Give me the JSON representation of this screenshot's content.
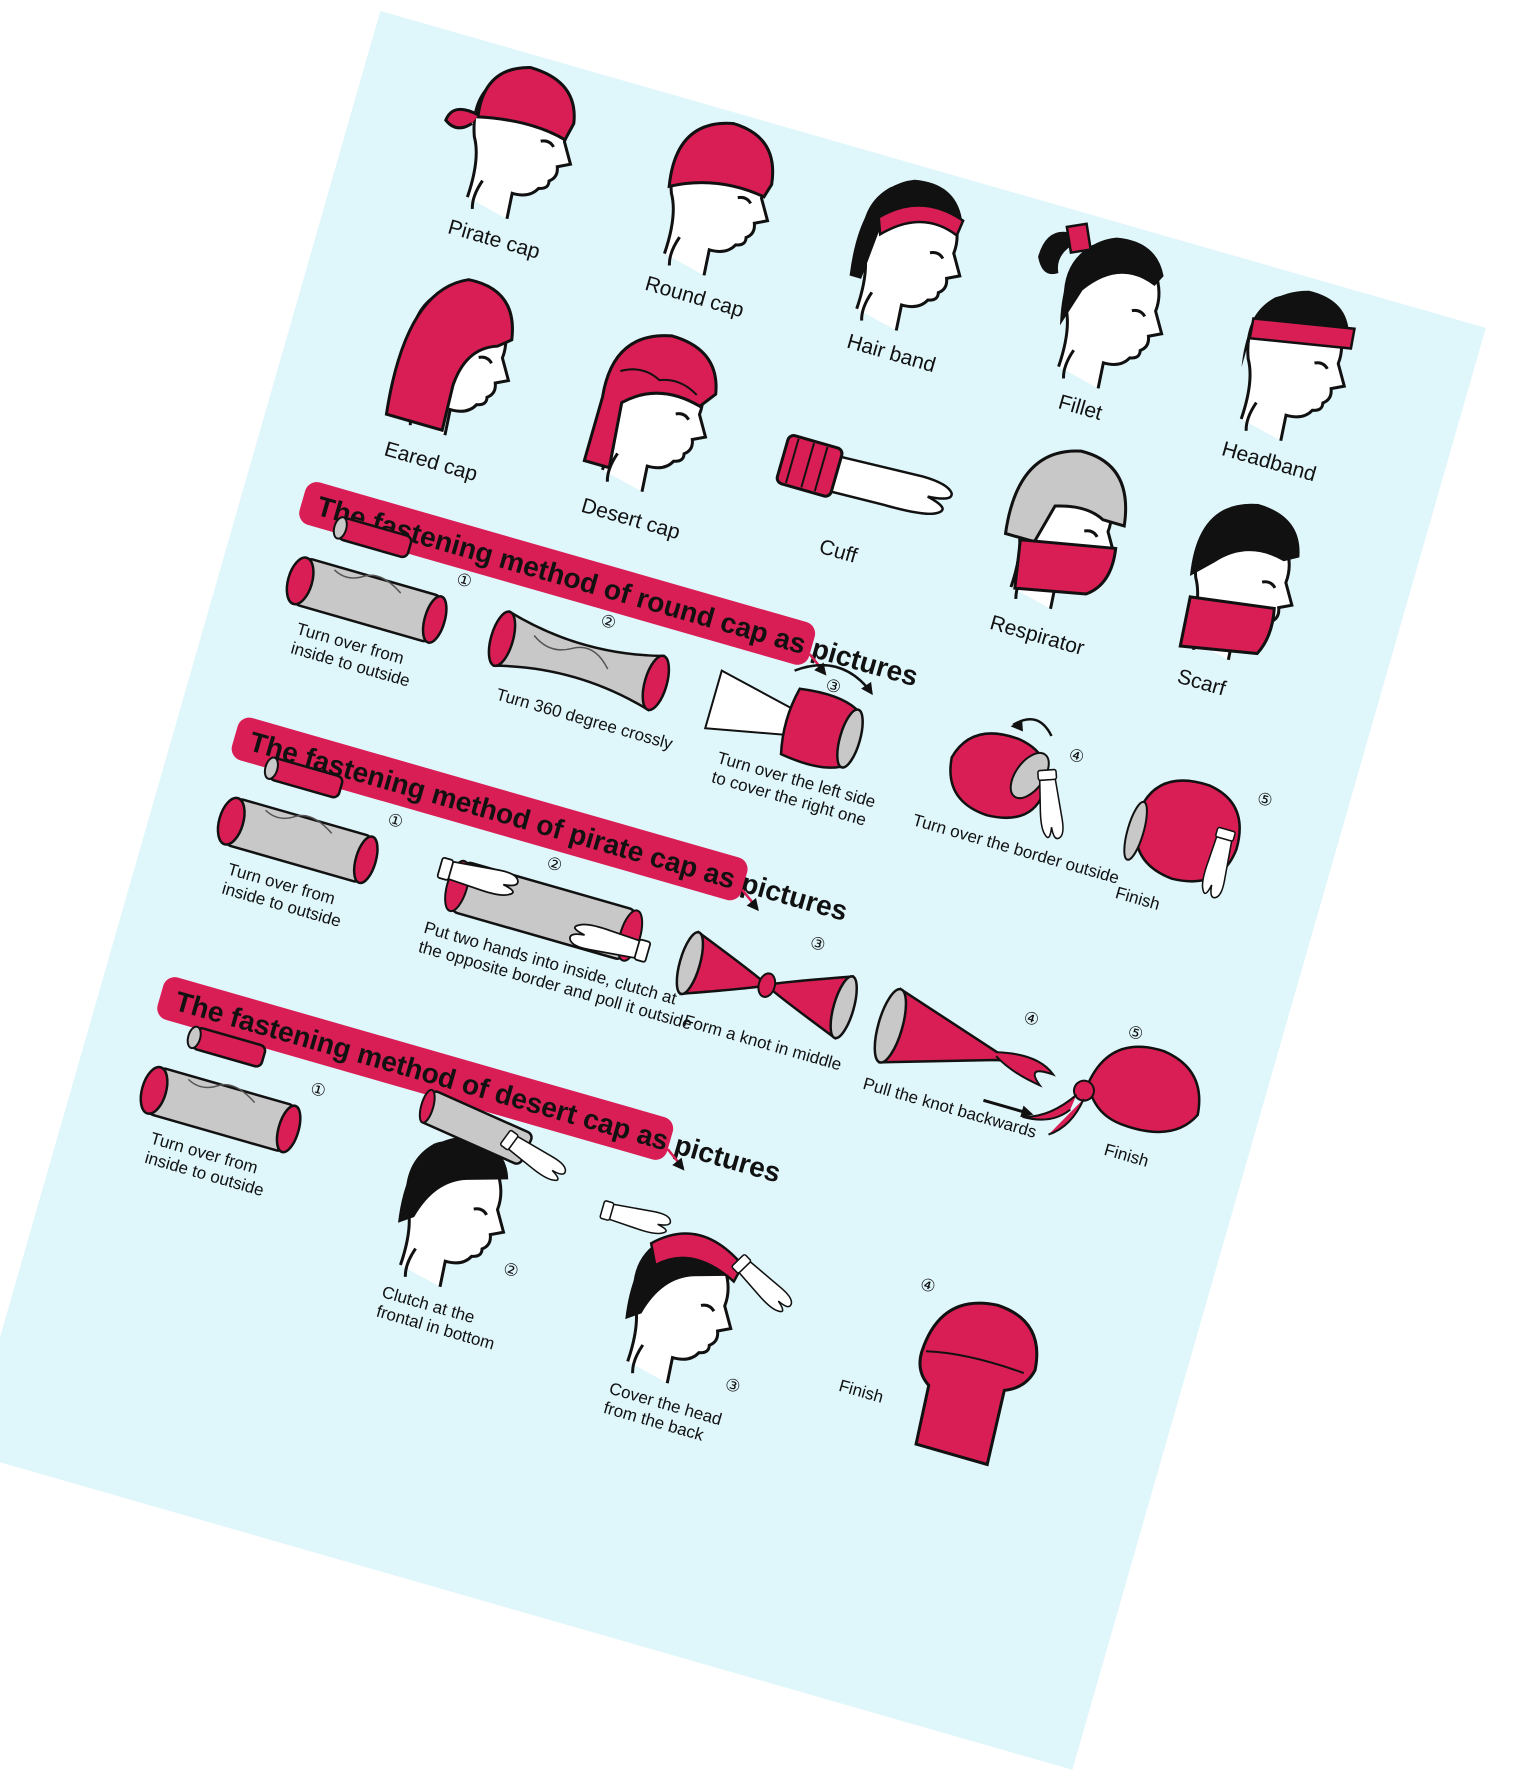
{
  "colors": {
    "accent": "#d81e54",
    "sheet": "#dff6fb",
    "ink": "#111111",
    "grey": "#c8c8c8"
  },
  "styles": [
    {
      "name": "Pirate cap"
    },
    {
      "name": "Round cap"
    },
    {
      "name": "Hair band"
    },
    {
      "name": "Fillet"
    },
    {
      "name": "Headband"
    },
    {
      "name": "Eared cap"
    },
    {
      "name": "Desert cap"
    },
    {
      "name": "Cuff"
    },
    {
      "name": "Respirator"
    },
    {
      "name": "Scarf"
    }
  ],
  "sections": [
    {
      "title": "The fastening method of round cap as pictures",
      "steps": [
        {
          "num": "①",
          "label": [
            "Turn over from",
            "inside to outside"
          ]
        },
        {
          "num": "②",
          "label": [
            "Turn 360 degree crossly"
          ]
        },
        {
          "num": "③",
          "label": [
            "Turn over the left side",
            "to cover the right one"
          ]
        },
        {
          "num": "④",
          "label": [
            "Turn over the border outside"
          ]
        },
        {
          "num": "⑤",
          "label": [
            "Finish"
          ]
        }
      ]
    },
    {
      "title": "The fastening method of pirate cap as pictures",
      "steps": [
        {
          "num": "①",
          "label": [
            "Turn over from",
            "inside to outside"
          ]
        },
        {
          "num": "②",
          "label": [
            "Put two hands into inside, clutch at",
            "the opposite border and poll it outside"
          ]
        },
        {
          "num": "③",
          "label": [
            "Form a knot in middle"
          ]
        },
        {
          "num": "④",
          "label": [
            "Pull the knot backwards"
          ]
        },
        {
          "num": "⑤",
          "label": [
            "Finish"
          ]
        }
      ]
    },
    {
      "title": "The fastening method of desert cap as pictures",
      "steps": [
        {
          "num": "①",
          "label": [
            "Turn over from",
            "inside to outside"
          ]
        },
        {
          "num": "②",
          "label": [
            "Clutch at the",
            "frontal in bottom"
          ]
        },
        {
          "num": "③",
          "label": [
            "Cover the head",
            "from the back"
          ]
        },
        {
          "num": "④",
          "label": [
            "Finish"
          ]
        }
      ]
    }
  ]
}
